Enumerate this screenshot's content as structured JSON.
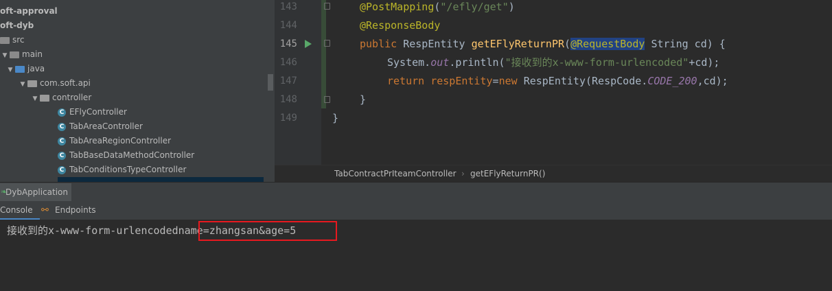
{
  "project_tree": {
    "items": [
      {
        "label": "oft-approval",
        "bold": true,
        "icon": "none"
      },
      {
        "label": "oft-dyb",
        "bold": true,
        "icon": "none"
      },
      {
        "label": "src",
        "icon": "folder-icon"
      },
      {
        "label": "main",
        "icon": "folder-icon",
        "arrow": "▼"
      },
      {
        "label": "java",
        "icon": "source-folder-icon",
        "arrow": "▼"
      },
      {
        "label": "com.soft.api",
        "icon": "package-icon",
        "arrow": "▼"
      },
      {
        "label": "controller",
        "icon": "package-icon",
        "arrow": "▼"
      },
      {
        "label": "EFlyController",
        "icon": "class-icon"
      },
      {
        "label": "TabAreaController",
        "icon": "class-icon"
      },
      {
        "label": "TabAreaRegionController",
        "icon": "class-icon"
      },
      {
        "label": "TabBaseDataMethodController",
        "icon": "class-icon"
      },
      {
        "label": "TabConditionsTypeController",
        "icon": "class-icon"
      }
    ]
  },
  "editor": {
    "line_numbers": [
      "143",
      "144",
      "145",
      "146",
      "147",
      "148",
      "149"
    ],
    "lines": [
      {
        "annotation": "@PostMapping",
        "paren_open": "(",
        "string": "\"/efly/get\"",
        "paren_close": ")"
      },
      {
        "annotation": "@ResponseBody"
      },
      {
        "kw": "public",
        "type": "RespEntity",
        "method": "getEFlyReturnPR",
        "paren_open": "(",
        "param_annotation": "@RequestBody",
        "param": "String cd",
        "tail": ") {"
      },
      {
        "prefix": "System.",
        "field": "out",
        "call": ".println(",
        "string": "\"接收到的x-www-form-urlencoded\"",
        "tail": "+cd);"
      },
      {
        "kw": "return",
        "var": "respEntity",
        "op": "=",
        "kw2": "new",
        "ctor": "RespEntity(RespCode.",
        "field": "CODE_200",
        "tail": ",cd);"
      },
      {
        "text": "}"
      },
      {
        "text": "}"
      }
    ]
  },
  "breadcrumb": {
    "items": [
      "TabContractPrIteamController",
      "getEFlyReturnPR()"
    ]
  },
  "run_panel": {
    "title": "DybApplication",
    "tabs": [
      "Console",
      "Endpoints"
    ]
  },
  "console": {
    "prefix": "接收到的x-www-form-urlencoded",
    "params": "name=zhangsan&age=5"
  },
  "colors": {
    "highlight_box": "#e8191f",
    "annotation": "#bbb529",
    "keyword": "#cc7832",
    "string": "#6a8759",
    "method": "#ffc66d"
  }
}
